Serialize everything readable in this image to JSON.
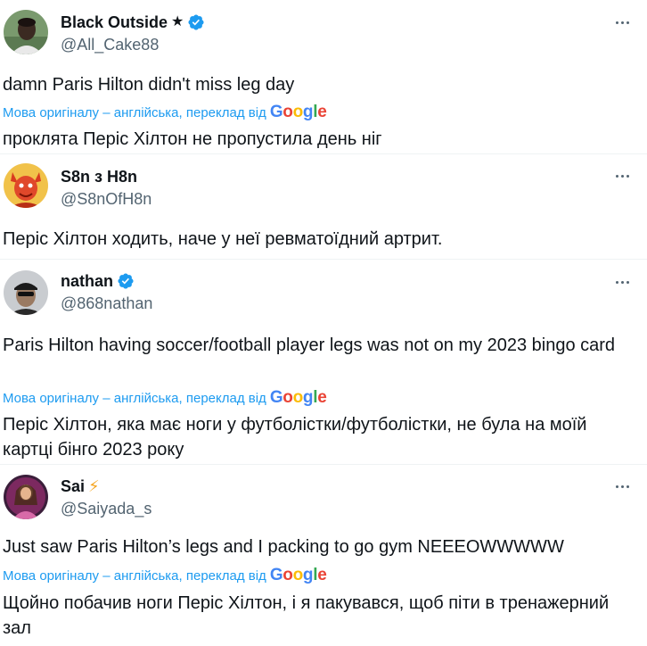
{
  "colors": {
    "accent": "#1d9bf0",
    "muted": "#536471",
    "text": "#0f1419",
    "separator": "#eff3f4"
  },
  "translation": {
    "note": "Мова оригіналу – англійська, переклад від",
    "brand": "Google"
  },
  "posts": [
    {
      "name": "Black Outside",
      "name_suffix": "★",
      "verified": true,
      "handle": "@All_Cake88",
      "text": "damn Paris Hilton didn't miss leg day",
      "translated_text": "проклята Періс Хілтон не пропустила день ніг",
      "avatar_icon": "avatar-person-icon"
    },
    {
      "name": "S8n з H8n",
      "verified": false,
      "handle": "@S8nOfH8n",
      "translated_text": "Періс Хілтон ходить, наче у неї ревматоїдний артрит.",
      "avatar_icon": "avatar-devil-icon"
    },
    {
      "name": "nathan",
      "verified": true,
      "handle": "@868nathan",
      "text": "Paris Hilton having soccer/football player legs was not on my 2023 bingo card",
      "translated_text": "Періс Хілтон, яка має ноги у футболістки/футболістки, не була на моїй картці бінго 2023 року",
      "avatar_icon": "avatar-person-cap-icon"
    },
    {
      "name": "Sai",
      "name_suffix": "⚡",
      "verified": false,
      "handle": "@Saiyada_s",
      "text": "Just saw Paris Hilton’s legs and I packing to go gym NEEEOWWWWW",
      "translated_text": "Щойно побачив ноги Періс Хілтон, і я пакувався, щоб піти в тренажерний зал",
      "avatar_icon": "avatar-woman-icon"
    }
  ]
}
